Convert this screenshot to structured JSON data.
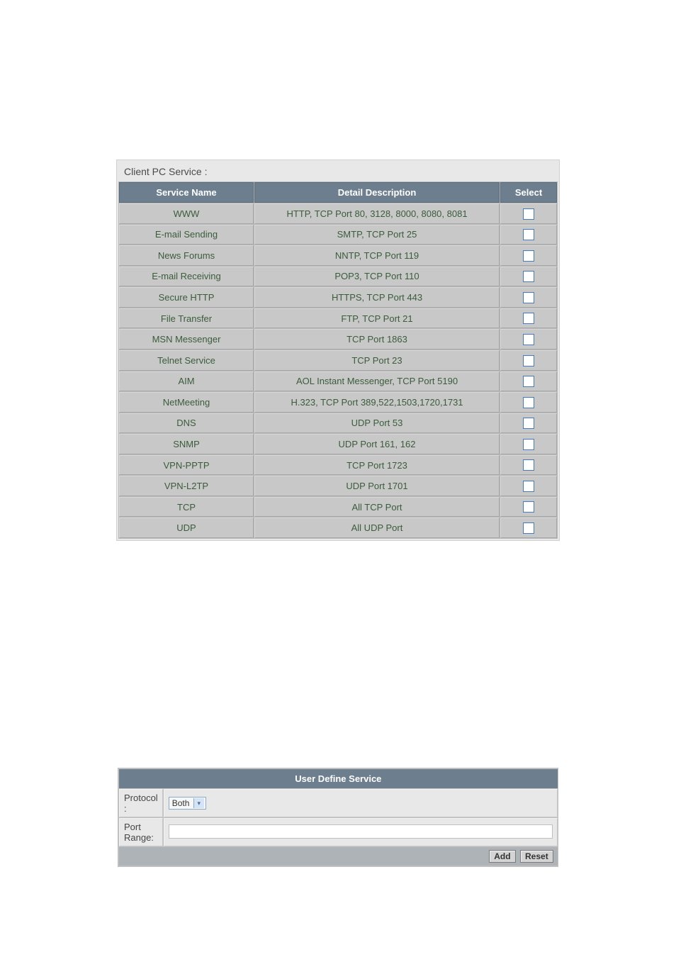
{
  "service_table": {
    "title": "Client PC Service :",
    "headers": [
      "Service Name",
      "Detail Description",
      "Select"
    ],
    "rows": [
      {
        "name": "WWW",
        "desc": "HTTP, TCP Port 80, 3128, 8000, 8080, 8081"
      },
      {
        "name": "E-mail Sending",
        "desc": "SMTP, TCP Port 25"
      },
      {
        "name": "News Forums",
        "desc": "NNTP, TCP Port 119"
      },
      {
        "name": "E-mail Receiving",
        "desc": "POP3, TCP Port 110"
      },
      {
        "name": "Secure HTTP",
        "desc": "HTTPS, TCP Port 443"
      },
      {
        "name": "File Transfer",
        "desc": "FTP, TCP Port 21"
      },
      {
        "name": "MSN Messenger",
        "desc": "TCP Port 1863"
      },
      {
        "name": "Telnet Service",
        "desc": "TCP Port 23"
      },
      {
        "name": "AIM",
        "desc": "AOL Instant Messenger, TCP Port 5190"
      },
      {
        "name": "NetMeeting",
        "desc": "H.323, TCP Port 389,522,1503,1720,1731"
      },
      {
        "name": "DNS",
        "desc": "UDP Port 53"
      },
      {
        "name": "SNMP",
        "desc": "UDP Port 161, 162"
      },
      {
        "name": "VPN-PPTP",
        "desc": "TCP Port 1723"
      },
      {
        "name": "VPN-L2TP",
        "desc": "UDP Port 1701"
      },
      {
        "name": "TCP",
        "desc": "All TCP Port"
      },
      {
        "name": "UDP",
        "desc": "All UDP Port"
      }
    ]
  },
  "user_define": {
    "title": "User Define Service",
    "protocol_label": "Protocol :",
    "protocol_value": "Both",
    "port_range_label": "Port Range:",
    "port_range_value": "",
    "add_button": "Add",
    "reset_button": "Reset"
  }
}
